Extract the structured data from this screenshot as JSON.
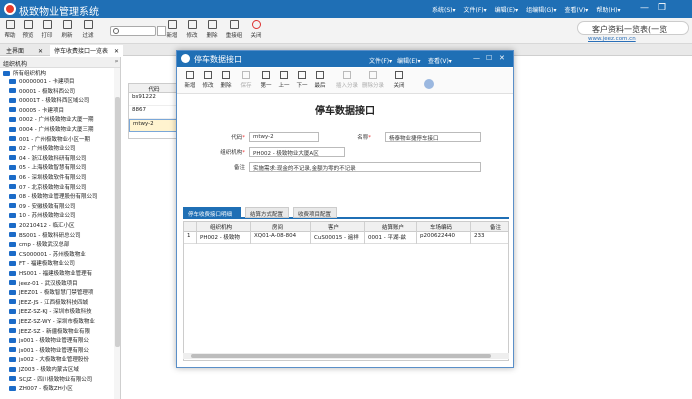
{
  "app": {
    "title": "极致物业管理系统",
    "menu": [
      "系统(S)▾",
      "文件(F)▾",
      "编辑(E)▾",
      "组编辑(G)▾",
      "查看(V)▾",
      "帮助(H)▾"
    ],
    "right_box": "客户资料一览表(一览",
    "url": "www.jeez.com.cn"
  },
  "toolbar": [
    "帮助",
    "预览",
    "打印",
    "刷新",
    "过滤",
    "新增",
    "修改",
    "删除",
    "重接组",
    "关闭"
  ],
  "tabs": [
    {
      "label": "主界面"
    },
    {
      "label": "停车收费接口一览表"
    }
  ],
  "tree": {
    "header": "组织机构",
    "root": "所有组织机构",
    "items": [
      "00000001 - 卡建项目",
      "00001 - 极致科西公司",
      "00001T - 极致科西区域公司",
      "00005 - 卡建项目",
      "0002 - 广州极致物业大厦一期",
      "0004 - 广州极致物业大厦三期",
      "001 - 广州极致物业小区一期",
      "02 - 广州极致物业公司",
      "04 - 浙江极致科研有限公司",
      "05 - 上海极致智慧有限公司",
      "06 - 深圳极致软件有限公司",
      "07 - 北京极致物业有限公司",
      "08 - 极致物业管理股份有限公司",
      "09 - 安徽极致有限公司",
      "10 - 苏州极致物业公司",
      "20210412 - 临汇小区",
      "BS001 - 极致科研总公司",
      "cmp - 极致武汉总部",
      "CS000001 - 苏州极致物业",
      "FT - 福建极致物业公司",
      "HS001 - 福建极致物业管理有",
      "jeez-01 - 武汉极致项目",
      "JEEZ01 - 极致智慧门禁管理项",
      "JEEZ-JS - 江西极致科技四城",
      "JEEZ-SZ-KJ - 深圳市极致科技",
      "JEEZ-SZ-WY - 深圳市极致物业",
      "JEEZ-SZ - 新疆极致物业有限",
      "js001 - 极致物业管理有限公",
      "js001 - 极致物业管理有限公",
      "js002 - 大极致物业管理股份",
      "JZ003 - 极致内蒙古区域",
      "SCJZ - 四川极致物业有限公司",
      "ZH007 - 极致ZH小区"
    ]
  },
  "list": {
    "header": "代码",
    "rows": [
      "bs91222",
      "8867",
      "mtwy-2"
    ]
  },
  "dialog": {
    "title": "停车数据接口",
    "menu": [
      "文件(F)▾",
      "编辑(E)▾",
      "查看(V)▾"
    ],
    "toolbar": [
      {
        "label": "新增",
        "disabled": false
      },
      {
        "label": "修改",
        "disabled": false
      },
      {
        "label": "删除",
        "disabled": false
      },
      {
        "label": "保存",
        "disabled": true
      },
      {
        "label": "第一",
        "disabled": false
      },
      {
        "label": "上一",
        "disabled": false
      },
      {
        "label": "下一",
        "disabled": false
      },
      {
        "label": "最后",
        "disabled": false
      },
      {
        "label": "插入分录",
        "disabled": true
      },
      {
        "label": "删除分录",
        "disabled": true
      },
      {
        "label": "关闭",
        "disabled": false
      }
    ],
    "form_title": "停车数据接口",
    "fields": {
      "code_label": "代码",
      "code": "mtwy-2",
      "name_label": "名称",
      "name": "杨泰物业捷停车接口",
      "org_label": "组织机构",
      "org": "PH002 - 极致物业大厦A区",
      "note_label": "备注",
      "note": "实施需求:现金的不记录,金额为零的不记录"
    },
    "tabs": [
      "停车收费接口明细",
      "结算方式配置",
      "收费项目配置"
    ],
    "grid": {
      "headers": [
        "组织机构",
        "房间",
        "客户",
        "结算账户",
        "车场编码",
        "备注"
      ],
      "rows": [
        [
          "PH002 - 极致物",
          "XQ01-A-08-804",
          "CuS00015 - 遍祥",
          "0001 - 平湖-兹",
          "p200622440",
          "233"
        ]
      ],
      "row_num": "1"
    }
  }
}
